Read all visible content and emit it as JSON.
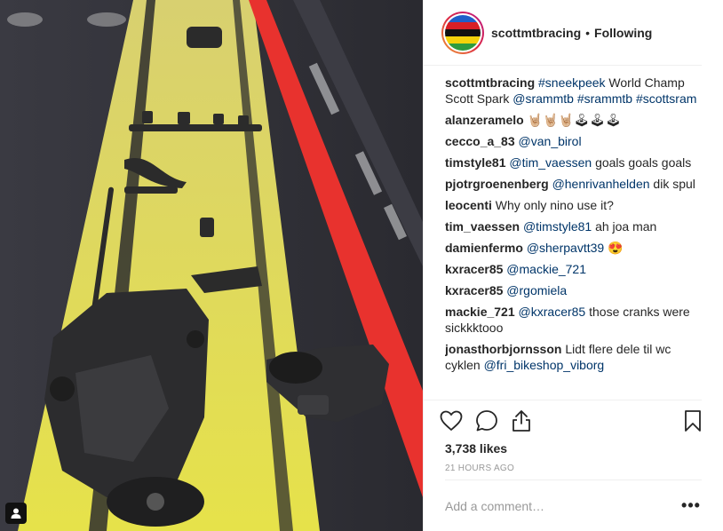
{
  "header": {
    "username": "scottmtbracing",
    "separator": "•",
    "follow_status": "Following"
  },
  "comments": [
    {
      "user": "scottmtbracing",
      "parts": [
        {
          "k": "m",
          "t": "#sneekpeek"
        },
        {
          "k": "t",
          "t": " World Champ Scott Spark "
        },
        {
          "k": "m",
          "t": "@srammtb"
        },
        {
          "k": "t",
          "t": " "
        },
        {
          "k": "m",
          "t": "#srammtb"
        },
        {
          "k": "t",
          "t": " "
        },
        {
          "k": "m",
          "t": "#scottsram"
        }
      ]
    },
    {
      "user": "alanzeramelo",
      "parts": [
        {
          "k": "t",
          "t": "🤘🏼🤘🏼🤘🏼🕹🕹🕹"
        }
      ]
    },
    {
      "user": "cecco_a_83",
      "parts": [
        {
          "k": "m",
          "t": "@van_birol"
        }
      ]
    },
    {
      "user": "timstyle81",
      "parts": [
        {
          "k": "m",
          "t": "@tim_vaessen"
        },
        {
          "k": "t",
          "t": " goals goals goals"
        }
      ]
    },
    {
      "user": "pjotrgroenenberg",
      "parts": [
        {
          "k": "m",
          "t": "@henrivanhelden"
        },
        {
          "k": "t",
          "t": " dik spul"
        }
      ]
    },
    {
      "user": "leocenti",
      "parts": [
        {
          "k": "t",
          "t": "Why only nino use it?"
        }
      ]
    },
    {
      "user": "tim_vaessen",
      "parts": [
        {
          "k": "m",
          "t": "@timstyle81"
        },
        {
          "k": "t",
          "t": " ah joa man"
        }
      ]
    },
    {
      "user": "damienfermo",
      "parts": [
        {
          "k": "m",
          "t": "@sherpavtt39"
        },
        {
          "k": "t",
          "t": " 😍"
        }
      ]
    },
    {
      "user": "kxracer85",
      "parts": [
        {
          "k": "m",
          "t": "@mackie_721"
        }
      ]
    },
    {
      "user": "kxracer85",
      "parts": [
        {
          "k": "m",
          "t": "@rgomiela"
        }
      ]
    },
    {
      "user": "mackie_721",
      "parts": [
        {
          "k": "m",
          "t": "@kxracer85"
        },
        {
          "k": "t",
          "t": " those cranks were sickkktooo"
        }
      ]
    },
    {
      "user": "jonasthorbjornsson",
      "parts": [
        {
          "k": "t",
          "t": "Lidt flere dele til wc cyklen "
        },
        {
          "k": "m",
          "t": "@fri_bikeshop_viborg"
        }
      ]
    }
  ],
  "actions": {
    "like_icon": "heart-icon",
    "comment_icon": "comment-icon",
    "share_icon": "share-icon",
    "save_icon": "bookmark-icon"
  },
  "likes_text": "3,738 likes",
  "time_text": "21 HOURS AGO",
  "comment_input": {
    "placeholder": "Add a comment…"
  },
  "more_label": "•••",
  "colors": {
    "mention": "#003569",
    "muted": "#999999",
    "border": "#efefef"
  }
}
